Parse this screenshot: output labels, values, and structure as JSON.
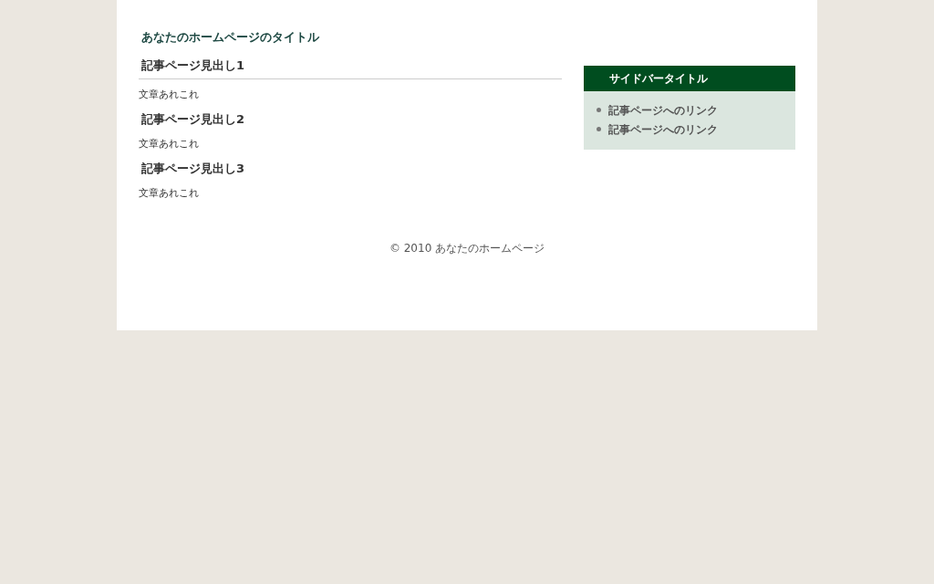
{
  "site_title": "あなたのホームページのタイトル",
  "articles": [
    {
      "heading": "記事ページ見出し1",
      "body": "文章あれこれ"
    },
    {
      "heading": "記事ページ見出し2",
      "body": "文章あれこれ"
    },
    {
      "heading": "記事ページ見出し3",
      "body": "文章あれこれ"
    }
  ],
  "sidebar": {
    "title": "サイドバータイトル",
    "links": [
      "記事ページへのリンク",
      "記事ページへのリンク"
    ]
  },
  "footer": "© 2010 あなたのホームページ"
}
